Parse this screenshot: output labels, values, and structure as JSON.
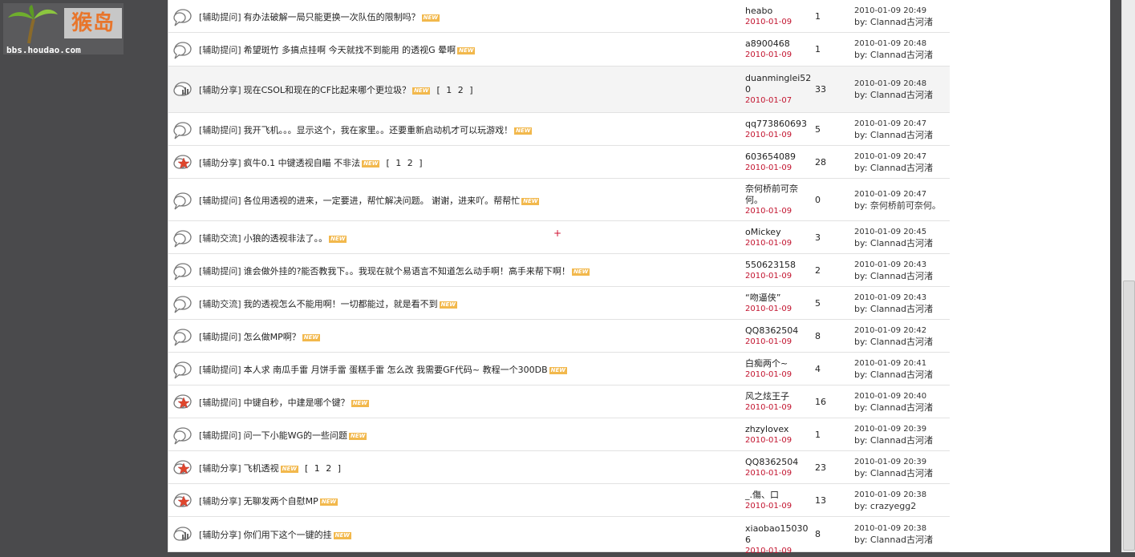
{
  "logo": {
    "brand": "猴岛",
    "url": "bbs.houdao.com"
  },
  "new_label": "NEW",
  "threads": [
    {
      "icon": "bubble",
      "category": "[辅助提问]",
      "title": "有办法破解一局只能更换一次队伍的限制吗？",
      "pages": "",
      "author": "heabo",
      "date": "2010-01-09",
      "replies": "1",
      "last_time": "2010-01-09 20:49",
      "last_by": "by: Clannad古河渚"
    },
    {
      "icon": "bubble",
      "category": "[辅助提问]",
      "title": "希望斑竹  多搞点挂啊  今天就找不到能用  的透视G  晕啊",
      "pages": "",
      "author": "a8900468",
      "date": "2010-01-09",
      "replies": "1",
      "last_time": "2010-01-09 20:48",
      "last_by": "by: Clannad古河渚"
    },
    {
      "icon": "hot",
      "category": "[辅助分享]",
      "title": "现在CSOL和现在的CF比起来哪个更垃圾？",
      "pages": "[ 1 2 ]",
      "author": "duanminglei520",
      "date": "2010-01-07",
      "replies": "33",
      "last_time": "2010-01-09 20:48",
      "last_by": "by: Clannad古河渚"
    },
    {
      "icon": "bubble",
      "category": "[辅助提问]",
      "title": "我开飞机。。。显示这个，我在家里。。还要重新启动机才可以玩游戏！",
      "pages": "",
      "author": "qq773860693",
      "date": "2010-01-09",
      "replies": "5",
      "last_time": "2010-01-09 20:47",
      "last_by": "by: Clannad古河渚"
    },
    {
      "icon": "star",
      "category": "[辅助分享]",
      "title": "疯牛0.1  中键透视自瞄  不非法",
      "pages": "[ 1 2 ]",
      "author": "603654089",
      "date": "2010-01-09",
      "replies": "28",
      "last_time": "2010-01-09 20:47",
      "last_by": "by: Clannad古河渚"
    },
    {
      "icon": "bubble",
      "category": "[辅助提问]",
      "title": "各位用透视的进来，一定要进，帮忙解决问题。  谢谢，进来吖。帮帮忙",
      "pages": "",
      "author": "奈何桥前可奈何。",
      "date": "2010-01-09",
      "replies": "0",
      "last_time": "2010-01-09 20:47",
      "last_by": "by: 奈何桥前可奈何。"
    },
    {
      "icon": "bubble",
      "category": "[辅助交流]",
      "title": "小狼的透视非法了。。",
      "pages": "",
      "author": "oMickey",
      "date": "2010-01-09",
      "replies": "3",
      "last_time": "2010-01-09 20:45",
      "last_by": "by: Clannad古河渚"
    },
    {
      "icon": "bubble",
      "category": "[辅助提问]",
      "title": "谁会做外挂的?能否教我下。。我现在就个易语言不知道怎么动手啊！高手来帮下啊！",
      "pages": "",
      "author": "550623158",
      "date": "2010-01-09",
      "replies": "2",
      "last_time": "2010-01-09 20:43",
      "last_by": "by: Clannad古河渚"
    },
    {
      "icon": "bubble",
      "category": "[辅助交流]",
      "title": "我的透视怎么不能用啊！一切都能过，就是看不到",
      "pages": "",
      "author": "“吻逼侠”",
      "date": "2010-01-09",
      "replies": "5",
      "last_time": "2010-01-09 20:43",
      "last_by": "by: Clannad古河渚"
    },
    {
      "icon": "bubble",
      "category": "[辅助提问]",
      "title": "怎么做MP啊？",
      "pages": "",
      "author": "QQ8362504",
      "date": "2010-01-09",
      "replies": "8",
      "last_time": "2010-01-09 20:42",
      "last_by": "by: Clannad古河渚"
    },
    {
      "icon": "bubble",
      "category": "[辅助提问]",
      "title": "本人求  南瓜手雷  月饼手雷  蛋糕手雷  怎么改  我需要GF代码~ 教程一个300DB",
      "pages": "",
      "author": "白痴两个~",
      "date": "2010-01-09",
      "replies": "4",
      "last_time": "2010-01-09 20:41",
      "last_by": "by: Clannad古河渚"
    },
    {
      "icon": "star",
      "category": "[辅助提问]",
      "title": "中键自秒，中建是哪个键？",
      "pages": "",
      "author": "风之炫王子",
      "date": "2010-01-09",
      "replies": "16",
      "last_time": "2010-01-09 20:40",
      "last_by": "by: Clannad古河渚"
    },
    {
      "icon": "bubble",
      "category": "[辅助提问]",
      "title": "问一下小能WG的一些问题",
      "pages": "",
      "author": "zhzylovex",
      "date": "2010-01-09",
      "replies": "1",
      "last_time": "2010-01-09 20:39",
      "last_by": "by: Clannad古河渚"
    },
    {
      "icon": "star",
      "category": "[辅助分享]",
      "title": "飞机透视",
      "pages": "[ 1 2 ]",
      "author": "QQ8362504",
      "date": "2010-01-09",
      "replies": "23",
      "last_time": "2010-01-09 20:39",
      "last_by": "by: Clannad古河渚"
    },
    {
      "icon": "star",
      "category": "[辅助分享]",
      "title": "无聊发两个自慰MP",
      "pages": "",
      "author": "_.傷、口",
      "date": "2010-01-09",
      "replies": "13",
      "last_time": "2010-01-09 20:38",
      "last_by": "by: crazyegg2"
    },
    {
      "icon": "hot",
      "category": "[辅助分享]",
      "title": "你们用下这个一键的挂",
      "pages": "",
      "author": "xiaobao150306",
      "date": "2010-01-09",
      "replies": "8",
      "last_time": "2010-01-09 20:38",
      "last_by": "by: Clannad古河渚"
    }
  ],
  "stray_mark": "+"
}
